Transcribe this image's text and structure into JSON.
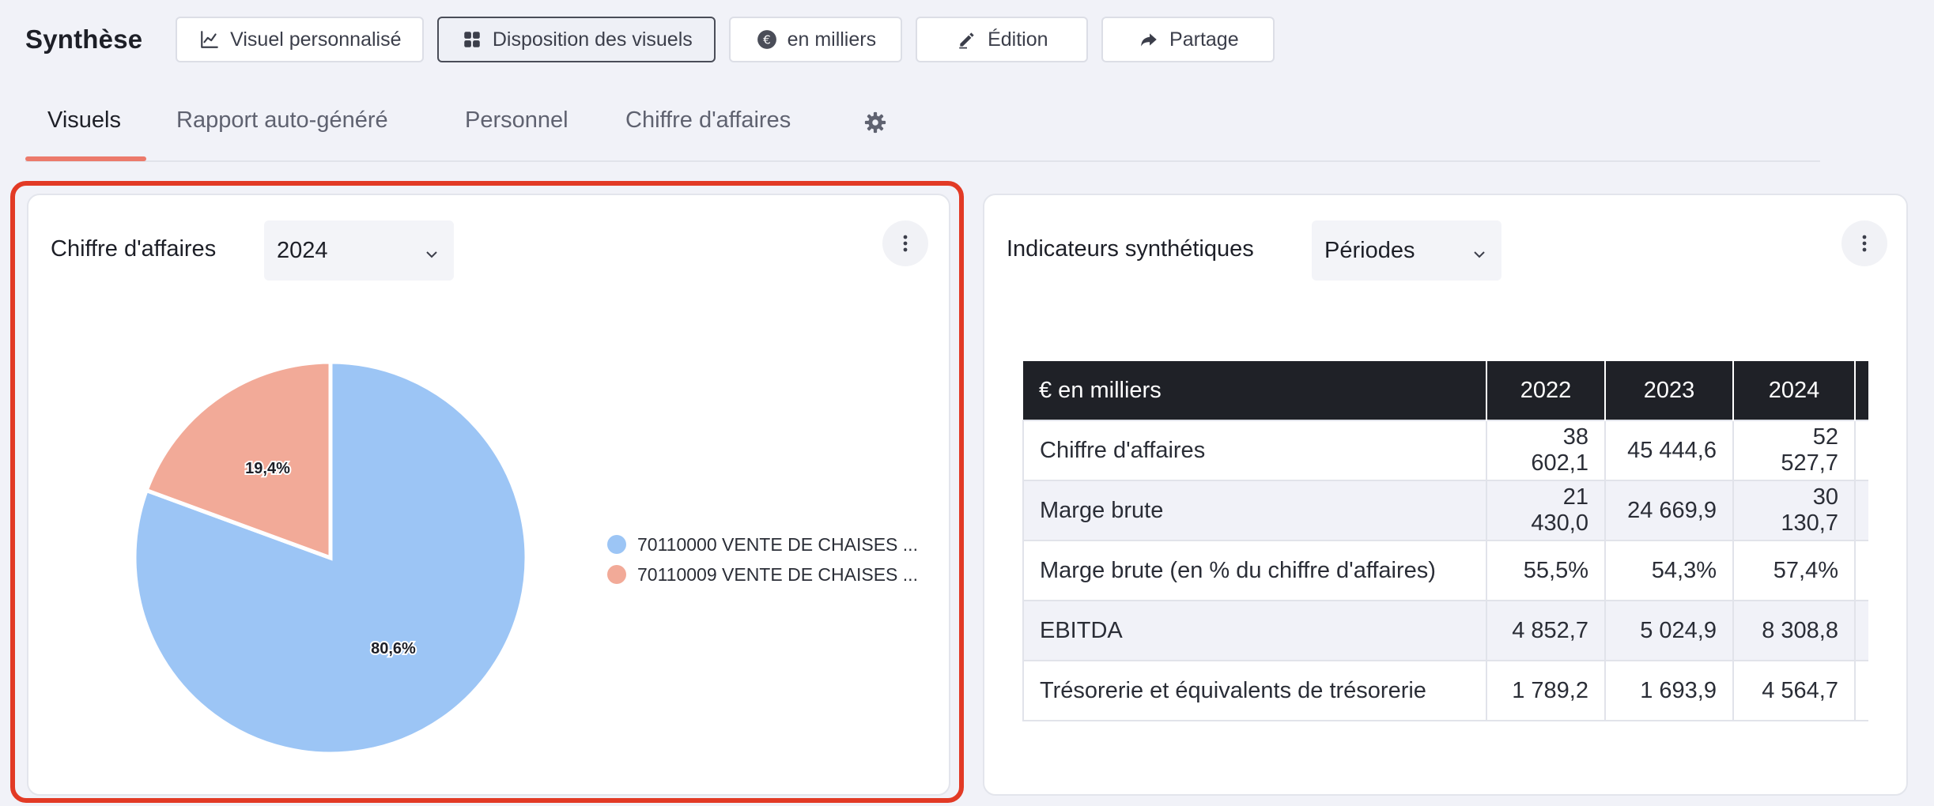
{
  "header": {
    "title": "Synthèse",
    "buttons": {
      "custom_visual": "Visuel personnalisé",
      "layout": "Disposition des visuels",
      "thousands": "en milliers",
      "edit": "Édition",
      "share": "Partage"
    }
  },
  "tabs": [
    "Visuels",
    "Rapport auto-généré",
    "Personnel",
    "Chiffre d'affaires"
  ],
  "active_tab": "Visuels",
  "left_card": {
    "title": "Chiffre d'affaires",
    "select_value": "2024",
    "legend": [
      "70110000 VENTE DE CHAISES ...",
      "70110009 VENTE DE CHAISES ..."
    ]
  },
  "right_card": {
    "title": "Indicateurs synthétiques",
    "select_value": "Périodes",
    "table": {
      "headers": [
        "€ en milliers",
        "2022",
        "2023",
        "2024"
      ],
      "rows": [
        [
          "Chiffre d'affaires",
          "38 602,1",
          "45 444,6",
          "52 527,7"
        ],
        [
          "Marge brute",
          "21 430,0",
          "24 669,9",
          "30 130,7"
        ],
        [
          "Marge brute (en % du chiffre d'affaires)",
          "55,5%",
          "54,3%",
          "57,4%"
        ],
        [
          "EBITDA",
          "4 852,7",
          "5 024,9",
          "8 308,8"
        ],
        [
          "Trésorerie et équivalents de trésorerie",
          "1 789,2",
          "1 693,9",
          "4 564,7"
        ]
      ]
    }
  },
  "chart_data": {
    "type": "pie",
    "categories": [
      "70110000 VENTE DE CHAISES ...",
      "70110009 VENTE DE CHAISES ..."
    ],
    "values": [
      80.6,
      19.4
    ],
    "labels": [
      "80,6%",
      "19,4%"
    ],
    "colors": [
      "#9cc5f5",
      "#f2aa98"
    ],
    "legend_position": "right"
  },
  "colors": {
    "accent": "#ec7a6b",
    "highlight": "#e23a25",
    "table_header": "#1f2127"
  }
}
